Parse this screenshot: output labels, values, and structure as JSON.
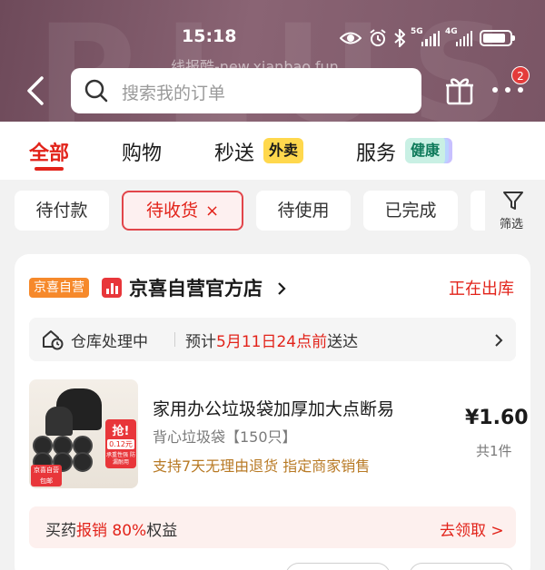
{
  "status_bar": {
    "time": "15:18",
    "network_1": "5G",
    "network_2": "4G",
    "battery_level": 0.85
  },
  "header": {
    "watermark_text": "PLUS",
    "site_watermark": "线报酷-new.xianbao.fun",
    "search_placeholder": "搜索我的订单",
    "notification_count": "2"
  },
  "tabs": {
    "all": "全部",
    "shopping": "购物",
    "flash": "秒送",
    "flash_badge": "外卖",
    "service": "服务",
    "service_badge": "健康"
  },
  "filters": {
    "pending_payment": "待付款",
    "pending_receipt": "待收货",
    "pending_receipt_close": "×",
    "pending_use": "待使用",
    "completed": "已完成",
    "filter_label": "筛选"
  },
  "order": {
    "store_tag": "京喜自营",
    "store_name": "京喜自营官方店",
    "status": "正在出库",
    "warehouse_status": "仓库处理中",
    "eta_prefix": "预计",
    "eta_highlight": "5月11日24点前",
    "eta_suffix": "送达",
    "product": {
      "title": "家用办公垃圾袋加厚加大点断易",
      "subtitle": "背心垃圾袋【150只】",
      "tags": "支持7天无理由退货  指定商家销售",
      "price": "¥1.60",
      "quantity": "共1件",
      "image_promo_label": "抢!",
      "image_promo_price": "0.12元",
      "image_promo_text": "承重性强 防漏耐用",
      "image_tag": "京喜自营 包邮"
    },
    "promo": {
      "prefix": "买药",
      "highlight": "报销 80%",
      "suffix": "权益",
      "action": "去领取 >"
    }
  },
  "colors": {
    "accent_red": "#e2231a",
    "header_bg": "#7a5565",
    "store_tag_orange": "#f6892b",
    "waimai_yellow": "#ffd84d"
  }
}
